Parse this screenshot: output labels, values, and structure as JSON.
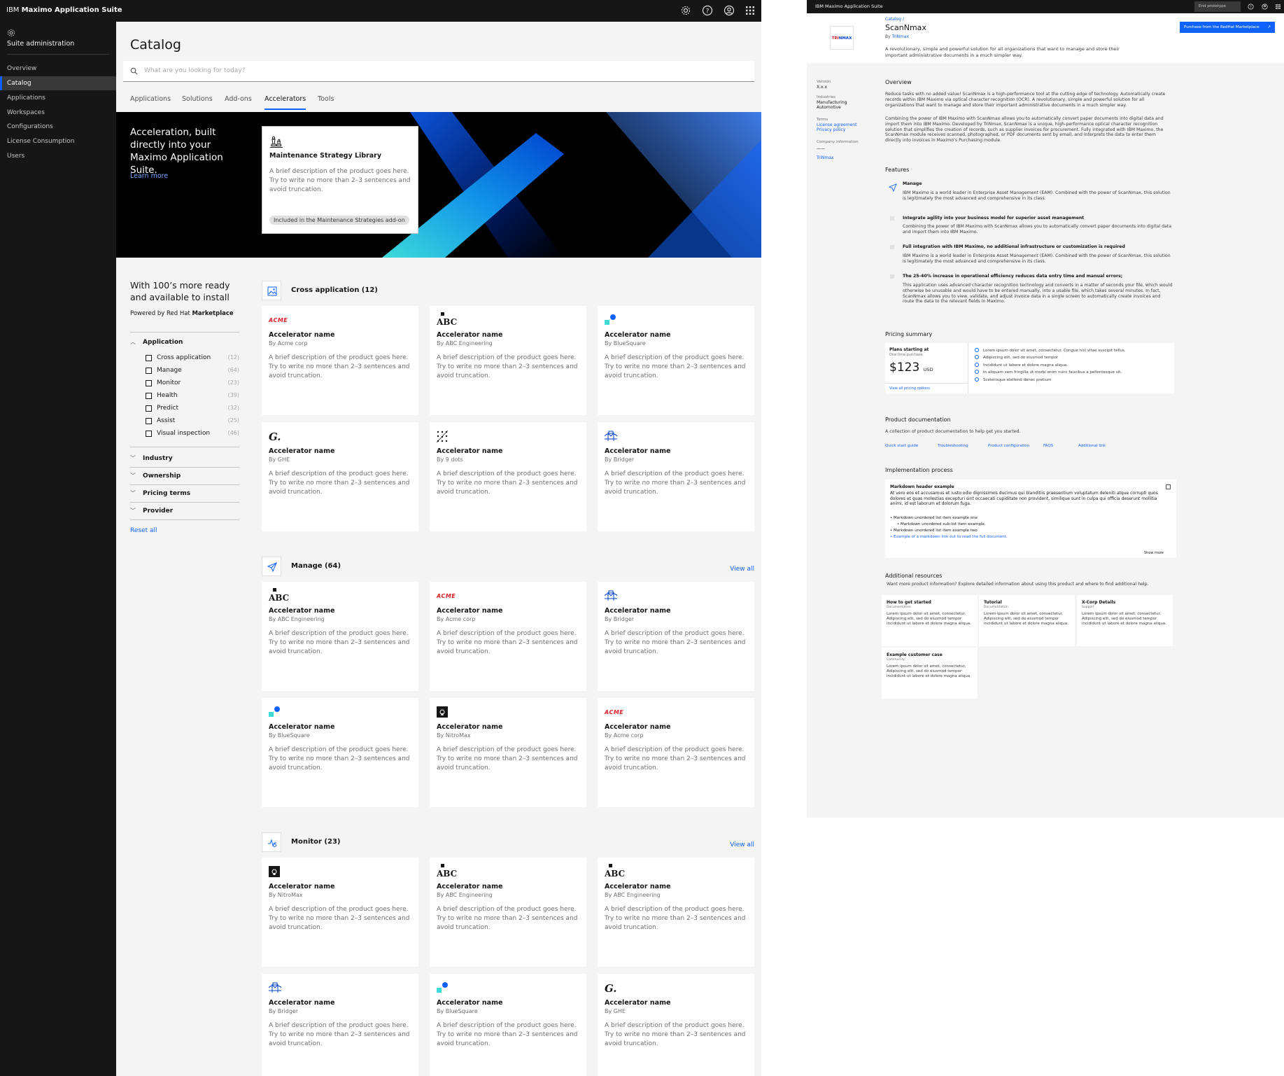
{
  "catalog_app": {
    "brand_prefix": "IBM",
    "brand_name": "Maximo Application Suite",
    "sidenav": {
      "title": "Suite administration",
      "items": [
        {
          "label": "Overview"
        },
        {
          "label": "Catalog"
        },
        {
          "label": "Applications"
        },
        {
          "label": "Workspaces"
        },
        {
          "label": "Configurations"
        },
        {
          "label": "License Consumption"
        },
        {
          "label": "Users"
        }
      ],
      "active_item": "Catalog"
    },
    "page_title": "Catalog",
    "search_placeholder": "What are you looking for today?",
    "tabs": [
      "Applications",
      "Solutions",
      "Add-ons",
      "Accelerators",
      "Tools"
    ],
    "active_tab": "Accelerators",
    "hero": {
      "title": "Acceleration, built directly into your Maximo Application Suite.",
      "link": "Learn more",
      "card_title": "Maintenance Strategy Library",
      "card_desc": "A brief description of the product goes here. Try to write no more than 2–3 sentences and avoid truncation.",
      "card_tag": "Included in the Maintenance Strategies add-on"
    },
    "promo": {
      "title": "With 100’s more ready and available to install",
      "powered_prefix": "Powered by Red Hat",
      "powered_bold": "Marketplace"
    },
    "filters": {
      "application": {
        "label": "Application",
        "options": [
          {
            "label": "Cross application",
            "count": "(12)"
          },
          {
            "label": "Manage",
            "count": "(64)"
          },
          {
            "label": "Monitor",
            "count": "(23)"
          },
          {
            "label": "Health",
            "count": "(39)"
          },
          {
            "label": "Predict",
            "count": "(32)"
          },
          {
            "label": "Assist",
            "count": "(25)"
          },
          {
            "label": "Visual inspection",
            "count": "(46)"
          }
        ]
      },
      "collapsed": [
        "Industry",
        "Ownership",
        "Pricing terms",
        "Provider"
      ],
      "reset": "Reset all"
    },
    "card_name": "Accelerator name",
    "card_desc": "A brief description of the product goes here. Try to write no more than 2–3 sentences and avoid truncation.",
    "view_all": "View all",
    "sections": [
      {
        "title": "Cross application (12)",
        "icon": "image-icon",
        "cards": [
          {
            "by": "By Acme corp",
            "logo": "acme"
          },
          {
            "by": "By ABC Engineering",
            "logo": "abc"
          },
          {
            "by": "By BlueSquare",
            "logo": "bluesquare"
          },
          {
            "by": "By GHE",
            "logo": "ghe"
          },
          {
            "by": "By 9 dots",
            "logo": "9dots"
          },
          {
            "by": "By Bridger",
            "logo": "bridger"
          }
        ]
      },
      {
        "title": "Manage (64)",
        "icon": "paper-plane-icon",
        "cards": [
          {
            "by": "By ABC Engineering",
            "logo": "abc"
          },
          {
            "by": "By Acme corp",
            "logo": "acme"
          },
          {
            "by": "By Bridger",
            "logo": "bridger"
          },
          {
            "by": "By BlueSquare",
            "logo": "bluesquare"
          },
          {
            "by": "By NitroMax",
            "logo": "nitromax"
          },
          {
            "by": "By Acme corp",
            "logo": "acme"
          }
        ]
      },
      {
        "title": "Monitor (23)",
        "icon": "monitor-pulse-icon",
        "cards": [
          {
            "by": "By NitroMax",
            "logo": "nitromax"
          },
          {
            "by": "By ABC Engineering",
            "logo": "abc"
          },
          {
            "by": "By ABC Engineering",
            "logo": "abc"
          },
          {
            "by": "By Bridger",
            "logo": "bridger"
          },
          {
            "by": "By BlueSquare",
            "logo": "bluesquare"
          },
          {
            "by": "By GHE",
            "logo": "ghe"
          }
        ]
      }
    ]
  },
  "detail_app": {
    "brand": "IBM Maximo Application Suite",
    "end_prototype": "End prototype",
    "breadcrumb": "Catalog  /",
    "title": "ScanNmax",
    "by_prefix": "By",
    "by_vendor": "TriNmax",
    "logo_text_a": "TRI",
    "logo_text_b": "NMAX",
    "description": "A revolutionary, simple and powerful solution for all organizations that want to manage and store their important administrative documents in a much simpler way.",
    "purchase_button": "Purchase from the RedHat Marketplace",
    "meta": {
      "version_label": "Version",
      "version_value": "X.x.x",
      "industries_label": "Industries",
      "industries": [
        "Manufacturing",
        "Automotive"
      ],
      "terms_label": "Terms",
      "terms_links": [
        "License agreement",
        "Privacy policy"
      ],
      "company_label": "Company information",
      "company_value": "——",
      "company_link": "TriNmax"
    },
    "overview": {
      "heading": "Overview",
      "p1": "Reduce tasks with no added value! ScanNmax is a high-performance tool at the cutting edge of technology. Automatically create records within IBM Maximo via optical character recognition (OCR). A revolutionary, simple and powerful solution for all organizations that want to manage and store their important administrative documents in a much simpler way.",
      "p2": "Combining the power of IBM Maximo with ScanNmax allows you to automatically convert paper documents into digital data and import them into IBM Maximo. Developed by TriNmax, ScanNmax is a unique, high-performance optical character recognition solution that simplifies the creation of records, such as supplier invoices for procurement. Fully integrated with IBM Maximo, the ScanNmax module receives scanned, photographed, or PDF documents sent by email, and interprets the data to enter them directly into invoices in Maximo’s Purchasing module."
    },
    "features": {
      "heading": "Features",
      "items": [
        {
          "title": "Manage",
          "desc": "IBM Maximo is a world leader in Enterprise Asset Management (EAM). Combined with the power of ScanNmax, this solution is legitimately the most advanced and comprehensive in its class."
        },
        {
          "title": "Integrate agility into your business model for superior asset management",
          "desc": "Combining the power of IBM Maximo with ScanNmax allows you to automatically convert paper documents into digital data and import them into IBM Maximo."
        },
        {
          "title": "Full integration with IBM Maximo, no additional infrastructure or customization is required",
          "desc": "IBM Maximo is a world leader in Enterprise Asset Management (EAM). Combined with the power of ScanNmax, this solution is legitimately the most advanced and comprehensive in its class."
        },
        {
          "title": "The 25-40% increase in operational efficiency reduces data entry time and manual errors;",
          "desc": "This application uses advanced character recognition technology and converts in a matter of seconds your file, which would otherwise be unusable and would have to be entered manually, into a usable file, which takes several minutes. In fact, ScanNmax allows you to view, validate, and adjust invoice data in a single screen to automatically create invoices and route the data to the relevant fields in Maximo."
        }
      ]
    },
    "pricing": {
      "heading": "Pricing summary",
      "plan_label": "Plans starting at",
      "plan_sub": "One time purchase",
      "price": "$123",
      "currency": "USD",
      "link": "View all pricing options",
      "checks": [
        "Lorem ipsum dolor sit amet, consectetur. Congue nisi vitae suscipit tellus.",
        "Adipiscing elit, sed do eiusmod tempor",
        "Incididunt ut labore et dolore magna aliqua.",
        "In aliquam sem fringilla ut morbi enim nunc faucibus a pellentesque sit.",
        "Scelerisque eleifend donec pretium"
      ]
    },
    "documentation": {
      "heading": "Product documentation",
      "desc": "A collection of product documentation to help get you started.",
      "links": [
        "Quick start guide",
        "Troubleshooting",
        "Product configuration",
        "FAQS",
        "Additional link"
      ]
    },
    "implementation": {
      "heading": "Implementation process",
      "box_title": "Markdown header example",
      "box_text": "At vero eos et accusamus et iusto odio dignissimos ducimus qui blanditiis praesentium voluptatum deleniti atque corrupti quos dolores et quas molestias excepturi sint occaecati cupiditate non provident, similique sunt in culpa qui officia deserunt mollitia animi, id est laborum et dolorum fuga.",
      "list": [
        "Markdown unordered list item example one",
        "Markdown unordered sub-list item example.",
        "Markdown unordered list item example two",
        "Example of a markdown link out to read the full document."
      ],
      "show_more": "Show more"
    },
    "resources": {
      "heading": "Additional resources",
      "desc": "Want more product information? Explore detailed information about using this product and where to find additional help.",
      "cards": [
        {
          "title": "How to get started",
          "sub": "Documentation",
          "desc": "Lorem ipsum dolor sit amet, consectetur. Adipiscing elit, sed do eiusmod tempor incididunt ut labore et dolore magna aliqua."
        },
        {
          "title": "Tutorial",
          "sub": "Documentation",
          "desc": "Lorem ipsum dolor sit amet, consectetur. Adipiscing elit, sed do eiusmod tempor incididunt ut labore et dolore magna aliqua."
        },
        {
          "title": "X-Corp Details",
          "sub": "Support",
          "desc": "Lorem ipsum dolor sit amet, consectetur. Adipiscing elit, sed do eiusmod tempor incididunt ut labore et dolore magna aliqua."
        },
        {
          "title": "Example customer case",
          "sub": "Community",
          "desc": "Lorem ipsum dolor sit amet, consectetur. Adipiscing elit, sed do eiusmod tempor incididunt ut labore et dolore magna aliqua."
        }
      ]
    },
    "colors": {
      "accent": "#0f62fe",
      "acme_red": "#da1e28",
      "bluesquare_teal": "#3ddbd9"
    }
  }
}
